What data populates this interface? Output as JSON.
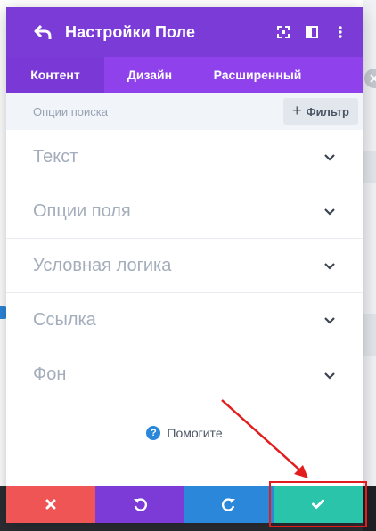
{
  "header": {
    "title": "Настройки Поле",
    "back_icon": "undo-arrow-icon",
    "icons": [
      "expand-icon",
      "split-view-icon",
      "more-vertical-icon"
    ]
  },
  "tabs": [
    {
      "label": "Контент",
      "active": true
    },
    {
      "label": "Дизайн",
      "active": false
    },
    {
      "label": "Расширенный",
      "active": false
    }
  ],
  "search": {
    "placeholder": "Опции поиска",
    "filter_label": "Фильтр"
  },
  "sections": [
    {
      "label": "Текст"
    },
    {
      "label": "Опции поля"
    },
    {
      "label": "Условная логика"
    },
    {
      "label": "Ссылка"
    },
    {
      "label": "Фон"
    }
  ],
  "help": {
    "label": "Помогите"
  },
  "footer": {
    "buttons": [
      "cancel-x-icon",
      "undo-icon",
      "redo-icon",
      "save-check-icon"
    ]
  },
  "colors": {
    "header": "#7b3bd6",
    "tabs": "#8f42ec",
    "cancel": "#ef5555",
    "undo": "#7c3bd6",
    "redo": "#2b87da",
    "save": "#29c4a9",
    "annotation": "#e31d1d"
  }
}
